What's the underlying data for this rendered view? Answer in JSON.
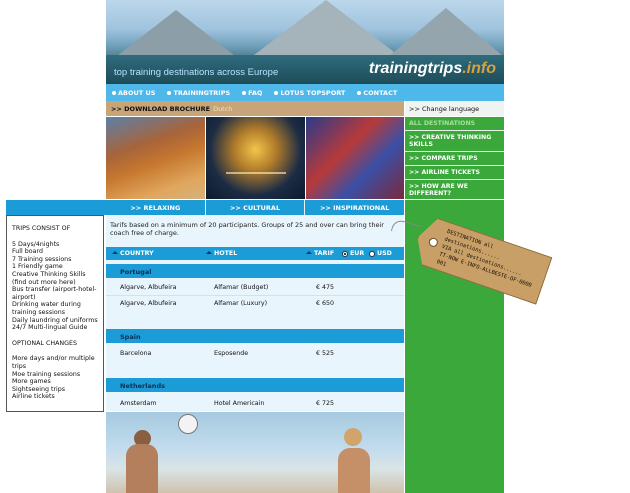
{
  "header": {
    "tagline": "top training destinations across Europe",
    "logo_part1": "trainingtrips",
    "logo_part2": ".info"
  },
  "nav": {
    "items": [
      {
        "label": "ABOUT US"
      },
      {
        "label": "TRAININGTRIPS"
      },
      {
        "label": "FAQ"
      },
      {
        "label": "LOTUS TOPSPORT"
      },
      {
        "label": "CONTACT"
      }
    ]
  },
  "brochure": {
    "label": ">> DOWNLOAD BROCHURE",
    "extra": "Dutch"
  },
  "language": {
    "label": ">> Change language"
  },
  "right_menu": {
    "items": [
      {
        "label": "ALL DESTINATIONS",
        "active": true
      },
      {
        "label": ">> CREATIVE THINKING SKILLS"
      },
      {
        "label": ">> COMPARE TRIPS"
      },
      {
        "label": ">> AIRLINE TICKETS"
      },
      {
        "label": ">> HOW ARE WE DIFFERENT?"
      }
    ]
  },
  "tabs": [
    {
      "label": ">> RELAXING"
    },
    {
      "label": ">> CULTURAL"
    },
    {
      "label": ">> INSPIRATIONAL"
    }
  ],
  "left_panel": {
    "title": "TRIPS CONSIST OF",
    "items": [
      "5 Days/4nights",
      "Full board",
      "7 Training sessions",
      "1 Friendly game",
      "Creative Thinking Skills (find out more here)",
      "Bus transfer (airport-hotel-airport)",
      "Drinking water during training sessions",
      "Daily laundring of uniforms",
      "24/7 Multi-lingual Guide"
    ],
    "optional_title": "OPTIONAL CHANGES",
    "optional_items": [
      "More days and/or multiple trips",
      "Moe training sessions",
      "More games",
      "Sightseeing trips",
      "Airline tickets"
    ]
  },
  "main": {
    "note": "Tarifs based on a minimum of 20 participants. Groups of 25 and over can bring their coach free of charge.",
    "columns": {
      "country": "COUNTRY",
      "hotel": "HOTEL",
      "tarif": "TARIF",
      "currency_eur": "EUR",
      "currency_usd": "USD"
    },
    "sections": [
      {
        "name": "Portugal",
        "rows": [
          {
            "location": "Algarve, Albufeira",
            "hotel": "Alfamar (Budget)",
            "price": "€ 475"
          },
          {
            "location": "Algarve, Albufeira",
            "hotel": "Alfamar (Luxury)",
            "price": "€ 650"
          }
        ]
      },
      {
        "name": "Spain",
        "rows": [
          {
            "location": "Barcelona",
            "hotel": "Esposende",
            "price": "€ 525"
          }
        ]
      },
      {
        "name": "Netherlands",
        "rows": [
          {
            "location": "Amsterdam",
            "hotel": "Hotel Americain",
            "price": "€ 725"
          }
        ]
      }
    ]
  },
  "tag": {
    "line1": "DESTINATION all destinations......",
    "line2": "VIA all destinations......",
    "line3": "TT-NOW E-INFO-ALLBESTE-OF-0000 001"
  }
}
